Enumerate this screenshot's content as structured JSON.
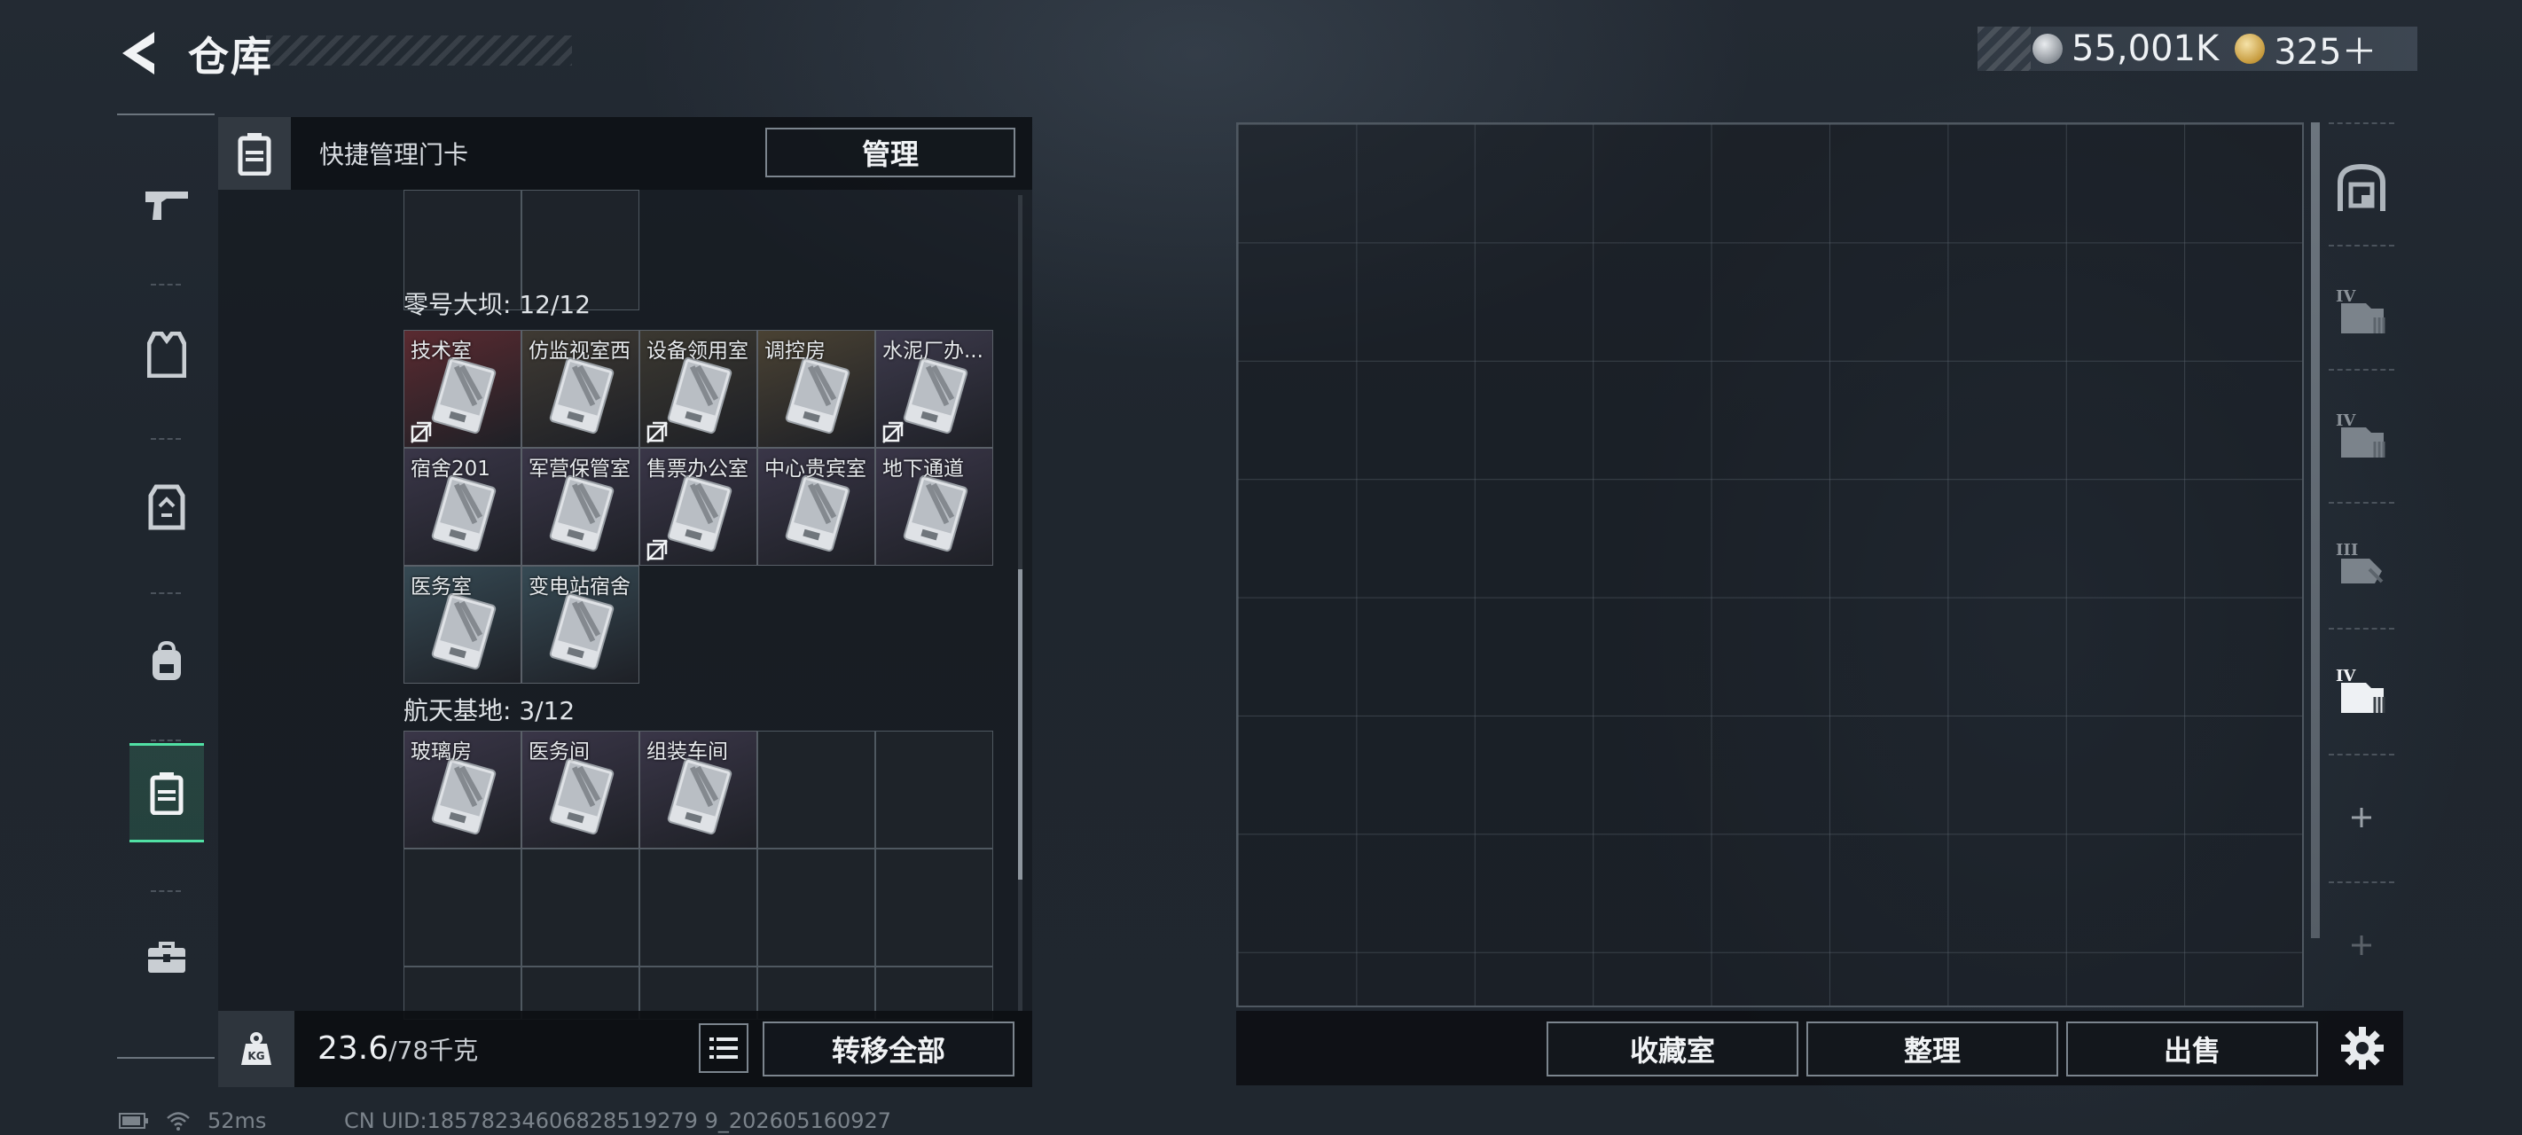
{
  "header": {
    "title": "仓库",
    "currency": [
      {
        "icon": "silver-coin-icon",
        "value": "55,001K"
      },
      {
        "icon": "gold-coin-icon",
        "value": "325＋"
      }
    ]
  },
  "left_tabs": [
    {
      "icon": "gun-icon",
      "active": false
    },
    {
      "icon": "vest-icon",
      "active": false
    },
    {
      "icon": "rig-icon",
      "active": false
    },
    {
      "icon": "backpack-icon",
      "active": false
    },
    {
      "icon": "keycard-case-icon",
      "active": true
    },
    {
      "icon": "toolbox-icon",
      "active": false
    }
  ],
  "inventory": {
    "header_label": "快捷管理门卡",
    "manage_label": "管理",
    "sections": [
      {
        "label": "零号大坝: 12/12",
        "cards": [
          {
            "name": "技术室",
            "color": "#5a2a30",
            "locked": true
          },
          {
            "name": "仿监视室西",
            "color": "#3f3a33",
            "locked": false
          },
          {
            "name": "设备领用室",
            "color": "#3b3830",
            "locked": true
          },
          {
            "name": "调控房",
            "color": "#4a4233",
            "locked": false
          },
          {
            "name": "水泥厂办...",
            "color": "#3d3a4c",
            "locked": true
          },
          {
            "name": "宿舍201",
            "color": "#3a3648",
            "locked": false
          },
          {
            "name": "军营保管室",
            "color": "#3a3648",
            "locked": false
          },
          {
            "name": "售票办公室",
            "color": "#3a3648",
            "locked": true
          },
          {
            "name": "中心贵宾室",
            "color": "#3a3648",
            "locked": false
          },
          {
            "name": "地下通道",
            "color": "#3a3648",
            "locked": false
          },
          {
            "name": "医务室",
            "color": "#364a54",
            "locked": false
          },
          {
            "name": "变电站宿舍",
            "color": "#364a54",
            "locked": false
          }
        ]
      },
      {
        "label": "航天基地: 3/12",
        "cards": [
          {
            "name": "玻璃房",
            "color": "#3a3648",
            "locked": false
          },
          {
            "name": "医务间",
            "color": "#3a3648",
            "locked": false
          },
          {
            "name": "组装车间",
            "color": "#3a3648",
            "locked": false
          }
        ]
      }
    ]
  },
  "weight": {
    "current": "23.6",
    "max": "/78千克"
  },
  "transfer_all_label": "转移全部",
  "storage_buttons": [
    "收藏室",
    "整理",
    "出售"
  ],
  "container_tabs": [
    {
      "icon": "safe-box-icon"
    },
    {
      "icon": "container-iv-icon"
    },
    {
      "icon": "container-iv-icon"
    },
    {
      "icon": "container-iii-icon"
    },
    {
      "icon": "container-iv-icon"
    },
    {
      "icon": "add-icon"
    },
    {
      "icon": "add-icon"
    }
  ],
  "footer": {
    "ping": "52ms",
    "uid": "CN UID:18578234606828519279 9_202605160927"
  }
}
